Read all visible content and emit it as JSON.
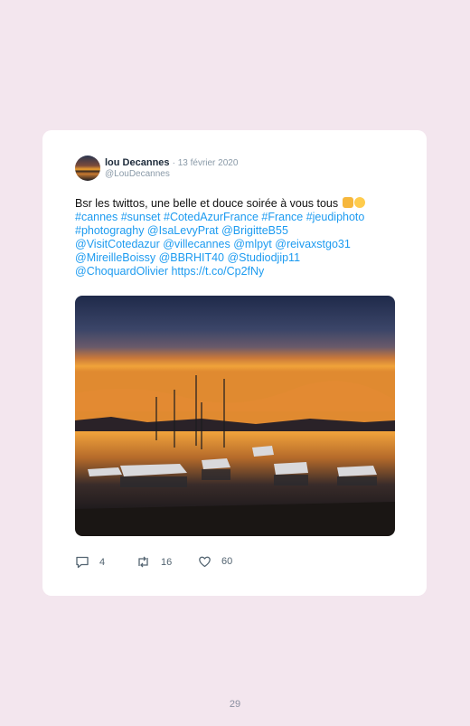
{
  "tweet": {
    "name": "lou Decannes",
    "date": "· 13 février 2020",
    "handle": "@LouDecannes",
    "text_plain": "Bsr les twittos, une belle et douce soirée à vous tous",
    "lines": [
      "#cannes #sunset #CotedAzurFrance #France #jeudiphoto",
      "#photograghy @IsaLevyPrat @BrigitteB55",
      "@VisitCotedazur @villecannes @mlpyt @reivaxstgo31",
      "@MireilleBoissy @BBRHIT40 @Studiodjip11",
      "@ChoquardOlivier https://t.co/Cp2fNy"
    ],
    "emoji": [
      "raising-hand-emoji",
      "winking-face-emoji"
    ],
    "photo_icon": "sunset-harbor-photo",
    "actions": {
      "reply_count": "4",
      "retweet_count": "16",
      "like_count": "60"
    }
  },
  "page_number": "29",
  "colors": {
    "background": "#f3e6ee",
    "link": "#1d9bf0",
    "card": "#ffffff"
  }
}
